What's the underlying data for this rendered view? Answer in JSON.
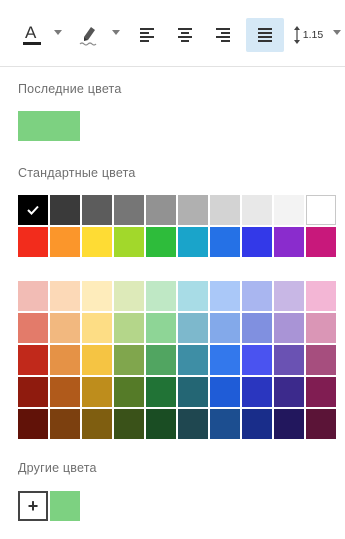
{
  "toolbar": {
    "items": [
      {
        "name": "text-color",
        "icon": "text-color-icon"
      },
      {
        "name": "highlight-color",
        "icon": "highlighter-icon"
      },
      {
        "name": "align-left",
        "icon": "align-left-icon"
      },
      {
        "name": "align-center",
        "icon": "align-center-icon"
      },
      {
        "name": "align-right",
        "icon": "align-right-icon"
      },
      {
        "name": "align-justify",
        "icon": "align-justify-icon",
        "active": true
      },
      {
        "name": "line-spacing",
        "icon": "line-spacing-icon",
        "label": "1.15"
      }
    ]
  },
  "recent": {
    "label": "Последние цвета",
    "colors": [
      "#7dd181"
    ]
  },
  "standard": {
    "label": "Стандартные цвета",
    "selected": "#000000",
    "rows": [
      [
        "#000000",
        "#3a3a3a",
        "#5c5c5c",
        "#767676",
        "#929292",
        "#b0b0b0",
        "#d3d3d3",
        "#e8e8e8",
        "#f3f3f3",
        "#ffffff"
      ],
      [
        "#f22c1c",
        "#fb962b",
        "#fedc34",
        "#a2d82b",
        "#2ebc3b",
        "#1aa4ca",
        "#2571e6",
        "#3339e8",
        "#8a2ccd",
        "#c8187b"
      ]
    ],
    "shade_rows": [
      [
        "#f2bcb5",
        "#fcd9b7",
        "#feecbb",
        "#ddeab9",
        "#bfe8c5",
        "#a8dce6",
        "#aac8f8",
        "#a9b6f0",
        "#c8b7e5",
        "#f3b6d5"
      ],
      [
        "#e37b6a",
        "#f2b87f",
        "#fddd85",
        "#b4d68a",
        "#8ed596",
        "#7db8cc",
        "#83a9ea",
        "#8090e0",
        "#a994d6",
        "#da96b6"
      ],
      [
        "#c1291b",
        "#e59246",
        "#f5c443",
        "#80a64d",
        "#51a561",
        "#3e8ea5",
        "#3378ec",
        "#4a53f0",
        "#6a52b3",
        "#a64e7e"
      ],
      [
        "#8f1b0e",
        "#b05a1b",
        "#be8d1c",
        "#557b28",
        "#217336",
        "#246674",
        "#1f5cd7",
        "#2a36bf",
        "#3c2a8c",
        "#801d52"
      ],
      [
        "#611208",
        "#7c400f",
        "#7f5e10",
        "#3a5219",
        "#1a4d23",
        "#1f4750",
        "#1c4e90",
        "#192d8a",
        "#22175d",
        "#5b1437"
      ]
    ]
  },
  "custom": {
    "label": "Другие цвета",
    "add_label": "+",
    "colors": [
      "#7dd181"
    ]
  }
}
